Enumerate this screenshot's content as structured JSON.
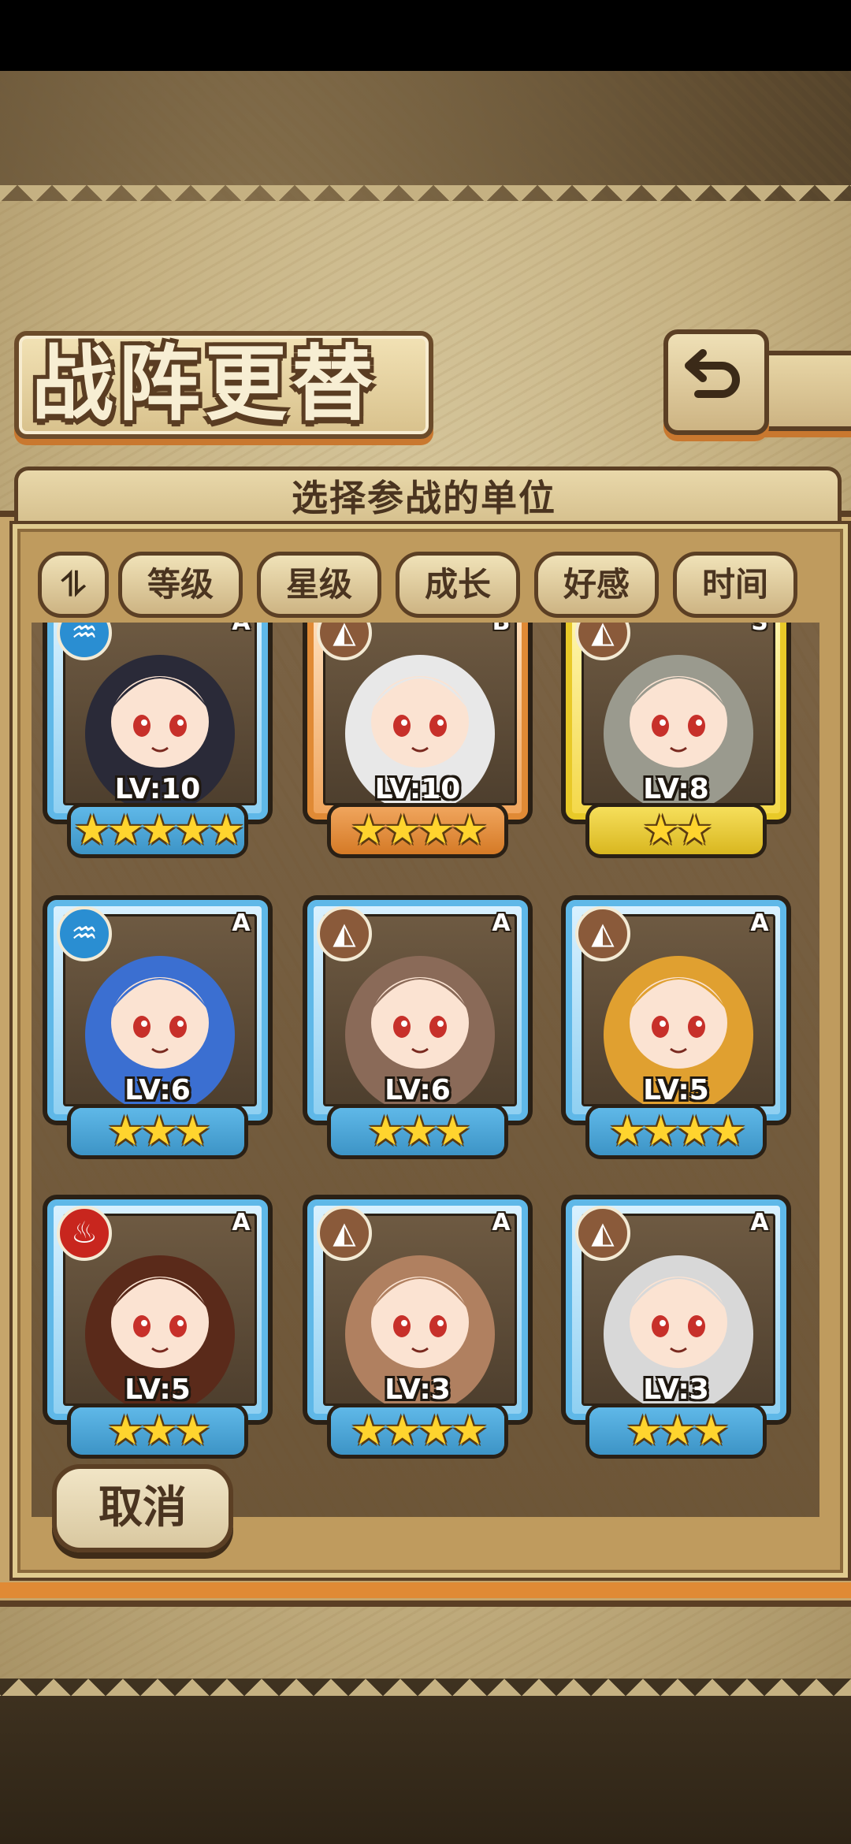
{
  "header": {
    "title": "战阵更替"
  },
  "panel": {
    "subtitle": "选择参战的单位"
  },
  "sort_tabs": [
    {
      "label": "等级"
    },
    {
      "label": "星级"
    },
    {
      "label": "成长"
    },
    {
      "label": "好感"
    },
    {
      "label": "时间"
    }
  ],
  "sort_toggle_label": "⥮",
  "cards": [
    {
      "element": "water",
      "rank": "A",
      "level": "LV:10",
      "stars": 5,
      "frame": "blue"
    },
    {
      "element": "earth",
      "rank": "B",
      "level": "LV:10",
      "stars": 4,
      "frame": "orange"
    },
    {
      "element": "earth",
      "rank": "S",
      "level": "LV:8",
      "stars": 2,
      "frame": "gold"
    },
    {
      "element": "water",
      "rank": "A",
      "level": "LV:6",
      "stars": 3,
      "frame": "blue"
    },
    {
      "element": "earth",
      "rank": "A",
      "level": "LV:6",
      "stars": 3,
      "frame": "blue"
    },
    {
      "element": "earth",
      "rank": "A",
      "level": "LV:5",
      "stars": 4,
      "frame": "blue"
    },
    {
      "element": "fire",
      "rank": "A",
      "level": "LV:5",
      "stars": 3,
      "frame": "blue"
    },
    {
      "element": "earth",
      "rank": "A",
      "level": "LV:3",
      "stars": 4,
      "frame": "blue"
    },
    {
      "element": "earth",
      "rank": "A",
      "level": "LV:3",
      "stars": 3,
      "frame": "blue"
    }
  ],
  "star_glyph": "★",
  "element_glyphs": {
    "water": "♒",
    "earth": "◭",
    "fire": "♨",
    "nature": "✿"
  },
  "cancel_label": "取消"
}
